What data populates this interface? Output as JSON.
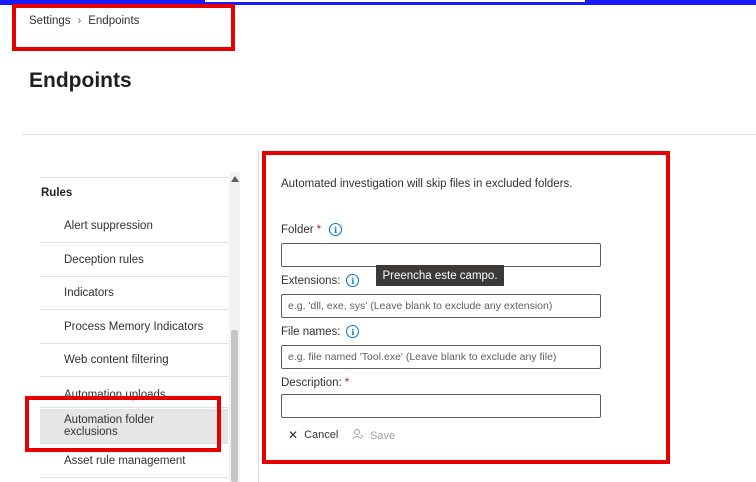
{
  "breadcrumb": {
    "root": "Settings",
    "current": "Endpoints",
    "separator_icon": "chevron-right-icon"
  },
  "page": {
    "title": "Endpoints"
  },
  "nav": {
    "section": "Rules",
    "items": [
      {
        "label": "Alert suppression"
      },
      {
        "label": "Deception rules"
      },
      {
        "label": "Indicators"
      },
      {
        "label": "Process Memory Indicators"
      },
      {
        "label": "Web content filtering"
      },
      {
        "label": "Automation uploads"
      },
      {
        "label": "Automation folder exclusions",
        "selected": true
      },
      {
        "label": "Asset rule management"
      }
    ]
  },
  "form": {
    "intro": "Automated investigation will skip files in excluded folders.",
    "folder": {
      "label": "Folder",
      "required_mark": "*",
      "value": ""
    },
    "extensions": {
      "label": "Extensions:",
      "placeholder": "e.g. 'dll, exe, sys' (Leave blank to exclude any extension)"
    },
    "file_names": {
      "label": "File names:",
      "placeholder": "e.g. file named 'Tool.exe' (Leave blank to exclude any file)"
    },
    "description": {
      "label": "Description:",
      "required_mark": "*",
      "value": ""
    },
    "tooltip": "Preencha este campo.",
    "cancel_label": "Cancel",
    "save_label": "Save"
  },
  "colors": {
    "accent": "#0078d4",
    "highlight": "#e60000",
    "top_bar": "#1a1aff"
  }
}
